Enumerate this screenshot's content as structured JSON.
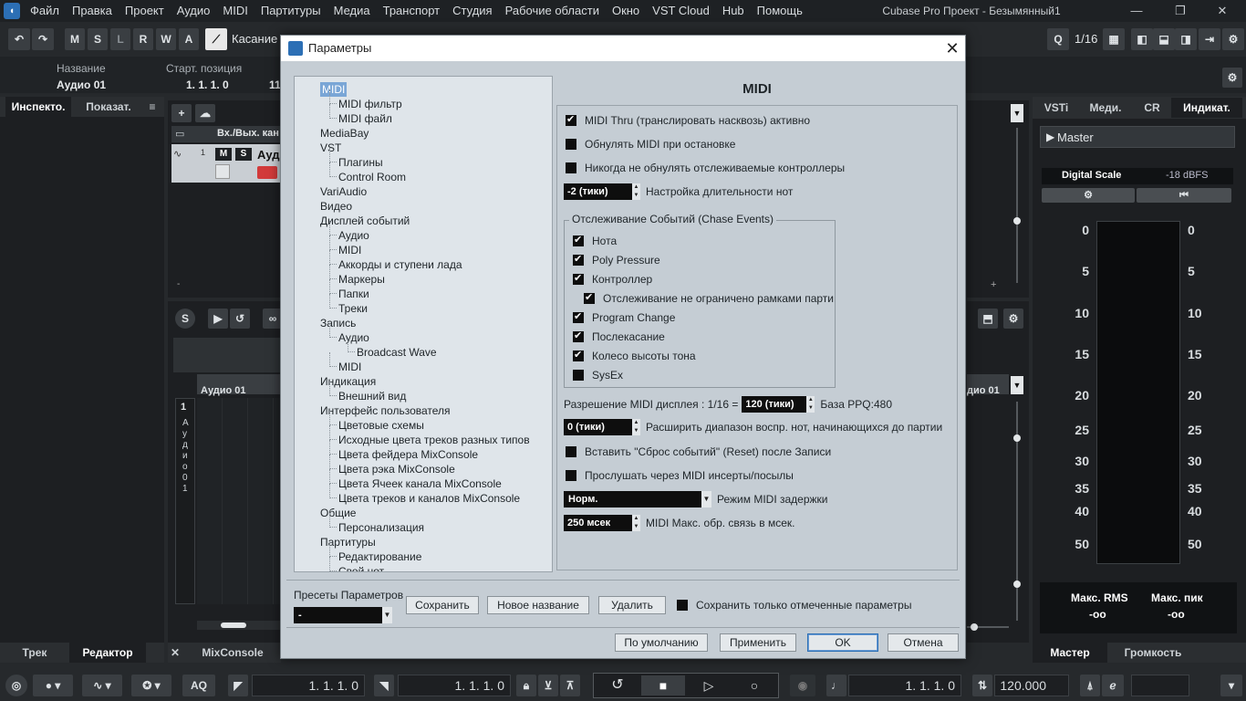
{
  "menubar": {
    "items": [
      "Файл",
      "Правка",
      "Проект",
      "Аудио",
      "MIDI",
      "Партитуры",
      "Медиа",
      "Транспорт",
      "Студия",
      "Рабочие области",
      "Окно",
      "VST Cloud",
      "Hub",
      "Помощь"
    ],
    "window_title": "Cubase Pro Проект - Безымянный1"
  },
  "toolbar": {
    "mode_buttons": [
      "M",
      "S",
      "L",
      "R",
      "W",
      "A"
    ],
    "automation_mode": "Касание",
    "quantize": "1/16"
  },
  "infoline": {
    "name_label": "Название",
    "name_value": "Аудио 01",
    "start_label": "Старт. позиция",
    "start_value": "1. 1. 1. 0",
    "trunc_value": "11"
  },
  "left_zone": {
    "tabs": [
      "Инспекто.",
      "Показат."
    ],
    "bottom_tabs": [
      "Трек",
      "Редактор"
    ],
    "mixconsole_tab": "MixConsole"
  },
  "project": {
    "io_header": "Вх./Вых. кан",
    "track_number": "1",
    "track_name": "Ауд",
    "editor_event": "Аудио 01",
    "editor_event_right": "дио 01",
    "editor_track_number": "1",
    "editor_track_vertical": "Аудио 01"
  },
  "right_zone": {
    "tabs": [
      "VSTi",
      "Меди.",
      "CR",
      "Индикат."
    ],
    "master_label": "Master",
    "digital_scale_label": "Digital Scale",
    "digital_scale_value": "-18 dBFS",
    "scale_marks": [
      "0",
      "5",
      "10",
      "15",
      "20",
      "25",
      "30",
      "35",
      "40",
      "50"
    ],
    "max_rms_label": "Макс. RMS",
    "max_rms_value": "-oo",
    "max_peak_label": "Макс. пик",
    "max_peak_value": "-oo",
    "bottom_tabs": [
      "Мастер",
      "Громкость"
    ]
  },
  "transport": {
    "left_locator": "1. 1. 1.  0",
    "right_locator": "1. 1. 1.  0",
    "position": "1. 1. 1.  0",
    "tempo": "120.000",
    "aq_label": "AQ"
  },
  "dialog": {
    "title": "Параметры",
    "close_glyph": "✕",
    "tree": [
      {
        "label": "MIDI",
        "level": 0,
        "selected": true
      },
      {
        "label": "MIDI фильтр",
        "level": 1
      },
      {
        "label": "MIDI файл",
        "level": 1
      },
      {
        "label": "MediaBay",
        "level": 0
      },
      {
        "label": "VST",
        "level": 0
      },
      {
        "label": "Плагины",
        "level": 1
      },
      {
        "label": "Control Room",
        "level": 1
      },
      {
        "label": "VariAudio",
        "level": 0
      },
      {
        "label": "Видео",
        "level": 0
      },
      {
        "label": "Дисплей событий",
        "level": 0
      },
      {
        "label": "Аудио",
        "level": 1
      },
      {
        "label": "MIDI",
        "level": 1
      },
      {
        "label": "Аккорды и ступени лада",
        "level": 1
      },
      {
        "label": "Маркеры",
        "level": 1
      },
      {
        "label": "Папки",
        "level": 1
      },
      {
        "label": "Треки",
        "level": 1
      },
      {
        "label": "Запись",
        "level": 0
      },
      {
        "label": "Аудио",
        "level": 1
      },
      {
        "label": "Broadcast Wave",
        "level": 2
      },
      {
        "label": "MIDI",
        "level": 1
      },
      {
        "label": "Индикация",
        "level": 0
      },
      {
        "label": "Внешний вид",
        "level": 1
      },
      {
        "label": "Интерфейс пользователя",
        "level": 0
      },
      {
        "label": "Цветовые схемы",
        "level": 1
      },
      {
        "label": "Исходные цвета треков разных типов",
        "level": 1
      },
      {
        "label": "Цвета фейдера MixConsole",
        "level": 1
      },
      {
        "label": "Цвета рэка MixConsole",
        "level": 1
      },
      {
        "label": "Цвета Ячеек канала MixConsole",
        "level": 1
      },
      {
        "label": "Цвета треков и каналов MixConsole",
        "level": 1
      },
      {
        "label": "Общие",
        "level": 0
      },
      {
        "label": "Персонализация",
        "level": 1
      },
      {
        "label": "Партитуры",
        "level": 0
      },
      {
        "label": "Редактирование",
        "level": 1
      },
      {
        "label": "Свой нот",
        "level": 1
      }
    ],
    "panel": {
      "title": "MIDI",
      "midi_thru": "MIDI Thru (транслировать насквозь) активно",
      "reset_on_stop": "Обнулять MIDI при остановке",
      "never_reset": "Никогда не обнулять отслеживаемые контроллеры",
      "note_length_value": "-2 (тики)",
      "note_length_label": "Настройка длительности нот",
      "chase_group": "Отслеживание Событий (Chase Events)",
      "chase_items": [
        {
          "label": "Нота",
          "checked": true,
          "indent": false
        },
        {
          "label": "Poly Pressure",
          "checked": true,
          "indent": false
        },
        {
          "label": "Контроллер",
          "checked": true,
          "indent": false
        },
        {
          "label": "Отслеживание не ограничено рамками парти",
          "checked": true,
          "indent": true
        },
        {
          "label": "Program Change",
          "checked": true,
          "indent": false
        },
        {
          "label": "Послекасание",
          "checked": true,
          "indent": false
        },
        {
          "label": "Колесо высоты тона",
          "checked": true,
          "indent": false
        },
        {
          "label": "SysEx",
          "checked": false,
          "indent": false
        }
      ],
      "resolution_label": "Разрешение MIDI дисплея : 1/16 =",
      "resolution_value": "120 (тики)",
      "ppq_label": "База PPQ:480",
      "extend_value": "0 (тики)",
      "extend_label": "Расширить диапазон воспр. нот, начинающихся до партии",
      "insert_reset": "Вставить \"Сброс событий\" (Reset) после Записи",
      "listen_inserts": "Прослушать через MIDI инсерты/посылы",
      "latency_value": "Норм.",
      "latency_label": "Режим MIDI задержки",
      "feedback_value": "250 мсек",
      "feedback_label": "MIDI Макс. обр. связь в мсек."
    },
    "presets": {
      "label": "Пресеты Параметров",
      "value": "-",
      "save": "Сохранить",
      "rename": "Новое название",
      "delete": "Удалить",
      "save_checked_only": "Сохранить только отмеченные параметры"
    },
    "buttons": {
      "defaults": "По умолчанию",
      "apply": "Применить",
      "ok": "OK",
      "cancel": "Отмена"
    }
  },
  "colors": {
    "accent": "#2c6fb5",
    "dialog_bg": "#c5cdd4",
    "daw_bg": "#26292c",
    "record": "#d23a3a"
  }
}
